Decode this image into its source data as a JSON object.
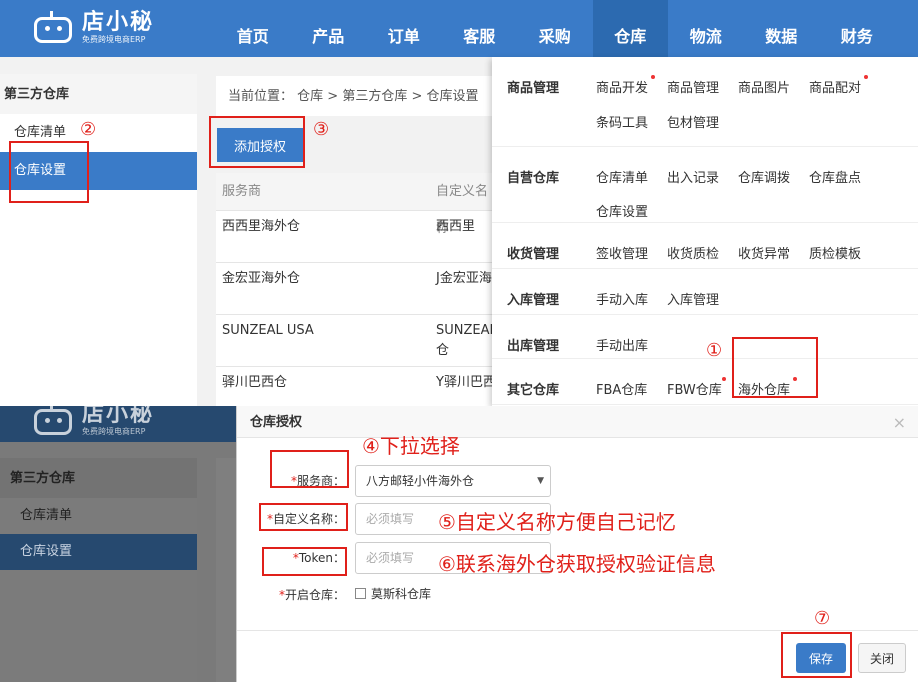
{
  "app": {
    "logo_name": "店小秘",
    "logo_tagline": "免费跨境电商ERP"
  },
  "nav": {
    "items": [
      "首页",
      "产品",
      "订单",
      "客服",
      "采购",
      "仓库",
      "物流",
      "数据",
      "财务"
    ],
    "active": "仓库"
  },
  "sidebar": {
    "title": "第三方仓库",
    "items": [
      "仓库清单",
      "仓库设置"
    ],
    "active": "仓库设置"
  },
  "breadcrumb": {
    "prefix": "当前位置：",
    "path": "仓库 > 第三方仓库 > 仓库设置"
  },
  "toolbar": {
    "add_auth_label": "添加授权"
  },
  "table": {
    "headers": [
      "服务商",
      "自定义名称"
    ],
    "rows": [
      [
        "西西里海外仓",
        "西西里"
      ],
      [
        "金宏亚海外仓",
        "J金宏亚海"
      ],
      [
        "SUNZEAL USA",
        "SUNZEAL 仓"
      ],
      [
        "驿川巴西仓",
        "Y驿川巴西"
      ]
    ]
  },
  "dropdown": {
    "groups": [
      {
        "category": "商品管理",
        "links": [
          "商品开发",
          "商品管理",
          "商品图片",
          "商品配对",
          "条码工具",
          "包材管理"
        ],
        "dots": [
          0,
          3
        ]
      },
      {
        "category": "自营仓库",
        "links": [
          "仓库清单",
          "出入记录",
          "仓库调拨",
          "仓库盘点",
          "仓库设置"
        ],
        "dots": []
      },
      {
        "category": "收货管理",
        "links": [
          "签收管理",
          "收货质检",
          "收货异常",
          "质检模板"
        ],
        "dots": []
      },
      {
        "category": "入库管理",
        "links": [
          "手动入库",
          "入库管理"
        ],
        "dots": []
      },
      {
        "category": "出库管理",
        "links": [
          "手动出库"
        ],
        "dots": []
      },
      {
        "category": "其它仓库",
        "links": [
          "FBA仓库",
          "FBW仓库",
          "海外仓库"
        ],
        "dots": [
          1,
          2
        ]
      }
    ]
  },
  "modal": {
    "title": "仓库授权",
    "close_glyph": "×",
    "fields": {
      "provider": {
        "label": "服务商：",
        "value": "八方邮轻小件海外仓"
      },
      "custom_name": {
        "label": "自定义名称：",
        "placeholder": "必须填写"
      },
      "token": {
        "label": "Token：",
        "placeholder": "必须填写"
      },
      "enable_warehouse": {
        "label": "开启仓库：",
        "option": "莫斯科仓库"
      }
    },
    "save_label": "保存",
    "close_label": "关闭"
  },
  "annotations": {
    "step1": "①",
    "step2": "②",
    "step3": "③",
    "step4": "④下拉选择",
    "step5": "⑤自定义名称方便自己记忆",
    "step6": "⑥联系海外仓获取授权验证信息",
    "step7": "⑦"
  },
  "colors": {
    "brand_blue": "#3a7bc8",
    "annotation_red": "#e0201a"
  }
}
